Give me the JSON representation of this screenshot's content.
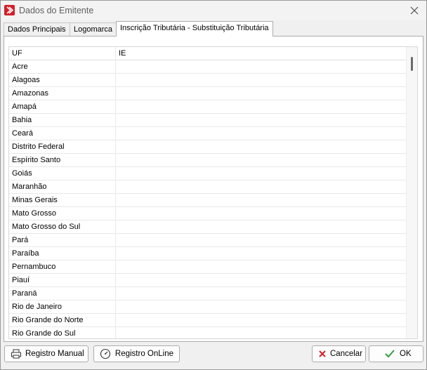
{
  "window": {
    "title": "Dados do Emitente"
  },
  "tabs": [
    {
      "label": "Dados Principais",
      "active": false
    },
    {
      "label": "Logomarca",
      "active": false
    },
    {
      "label": "Inscrição Tributária - Substituição Tributária",
      "active": true
    }
  ],
  "grid": {
    "columns": [
      "UF",
      "IE"
    ],
    "rows": [
      {
        "uf": "Acre",
        "ie": ""
      },
      {
        "uf": "Alagoas",
        "ie": ""
      },
      {
        "uf": "Amazonas",
        "ie": ""
      },
      {
        "uf": "Amapá",
        "ie": ""
      },
      {
        "uf": "Bahia",
        "ie": ""
      },
      {
        "uf": "Ceará",
        "ie": ""
      },
      {
        "uf": "Distrito Federal",
        "ie": ""
      },
      {
        "uf": "Espírito Santo",
        "ie": ""
      },
      {
        "uf": "Goiás",
        "ie": ""
      },
      {
        "uf": "Maranhão",
        "ie": ""
      },
      {
        "uf": "Minas Gerais",
        "ie": ""
      },
      {
        "uf": "Mato Grosso",
        "ie": ""
      },
      {
        "uf": "Mato Grosso do Sul",
        "ie": ""
      },
      {
        "uf": "Pará",
        "ie": ""
      },
      {
        "uf": "Paraíba",
        "ie": ""
      },
      {
        "uf": "Pernambuco",
        "ie": ""
      },
      {
        "uf": "Piauí",
        "ie": ""
      },
      {
        "uf": "Paraná",
        "ie": ""
      },
      {
        "uf": "Rio de Janeiro",
        "ie": ""
      },
      {
        "uf": "Rio Grande do Norte",
        "ie": ""
      },
      {
        "uf": "Rio Grande do Sul",
        "ie": ""
      }
    ]
  },
  "buttons": {
    "manual": {
      "label": "Registro Manual",
      "icon": "printer-icon"
    },
    "online": {
      "label": "Registro OnLine",
      "icon": "speedometer-icon"
    },
    "cancel": {
      "label": "Cancelar",
      "icon": "red-x-icon",
      "color": "#d4202a"
    },
    "ok": {
      "label": "OK",
      "icon": "green-check-icon",
      "color": "#2e9e3e"
    }
  },
  "colors": {
    "accent": "#d4202a",
    "ok": "#2e9e3e"
  }
}
